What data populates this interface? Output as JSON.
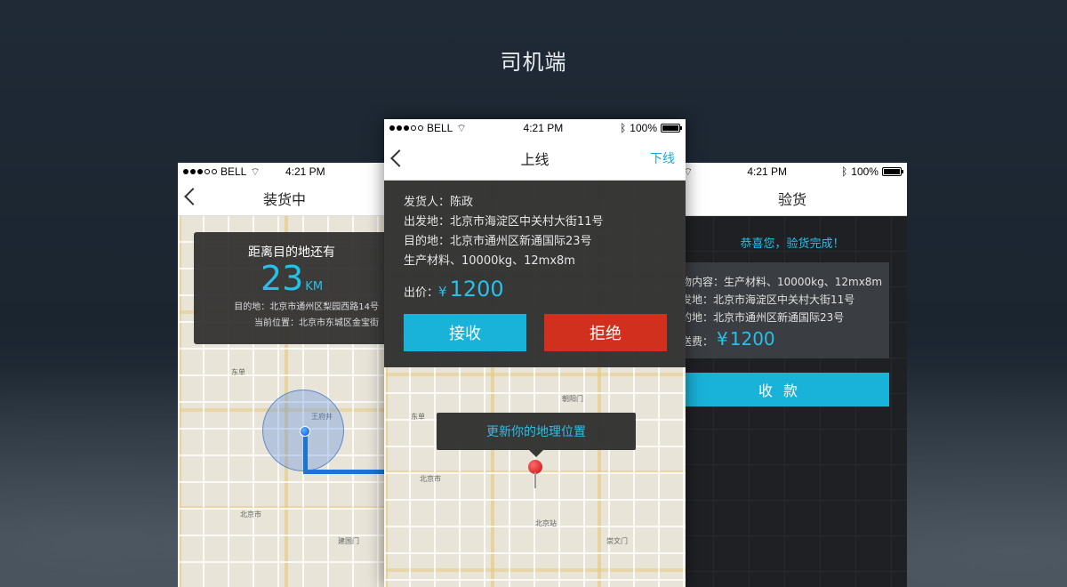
{
  "page_title": "司机端",
  "status_bar": {
    "carrier": "BELL",
    "time": "4:21 PM",
    "battery": "100%"
  },
  "left_screen": {
    "nav_title": "装货中",
    "distance_title": "距离目的地还有",
    "distance_value": "23",
    "distance_unit": "KM",
    "destination": "目的地：北京市通州区梨园西路14号",
    "current_location": "当前位置：北京市东城区金宝街"
  },
  "middle_screen": {
    "nav_title": "上线",
    "nav_right": "下线",
    "shipper": "发货人：陈政",
    "origin": "出发地：北京市海淀区中关村大街11号",
    "destination": "目的地：北京市通州区新通国际23号",
    "cargo": "生产材料、10000kg、12mx8m",
    "price_label": "出价：",
    "price_currency": "¥",
    "price_value": "1200",
    "accept_label": "接收",
    "reject_label": "拒绝",
    "tooltip": "更新你的地理位置"
  },
  "right_screen": {
    "nav_title": "验货",
    "congrats": "恭喜您，验货完成！",
    "cargo_content": "物内容：生产材料、10000kg、12mx8m",
    "origin": "发地：北京市海淀区中关村大街11号",
    "destination": "的地：北京市通州区新通国际23号",
    "freight_label": "送费：",
    "freight_currency": "¥",
    "freight_value": "1200",
    "collect_label": "收款"
  },
  "map_labels": [
    "北京站",
    "东单",
    "王府井",
    "朝阳门",
    "建国门",
    "崇文门",
    "北京市"
  ],
  "colors": {
    "accent": "#19b3da",
    "reject": "#d2301f",
    "overlay": "#2d2d2d"
  }
}
